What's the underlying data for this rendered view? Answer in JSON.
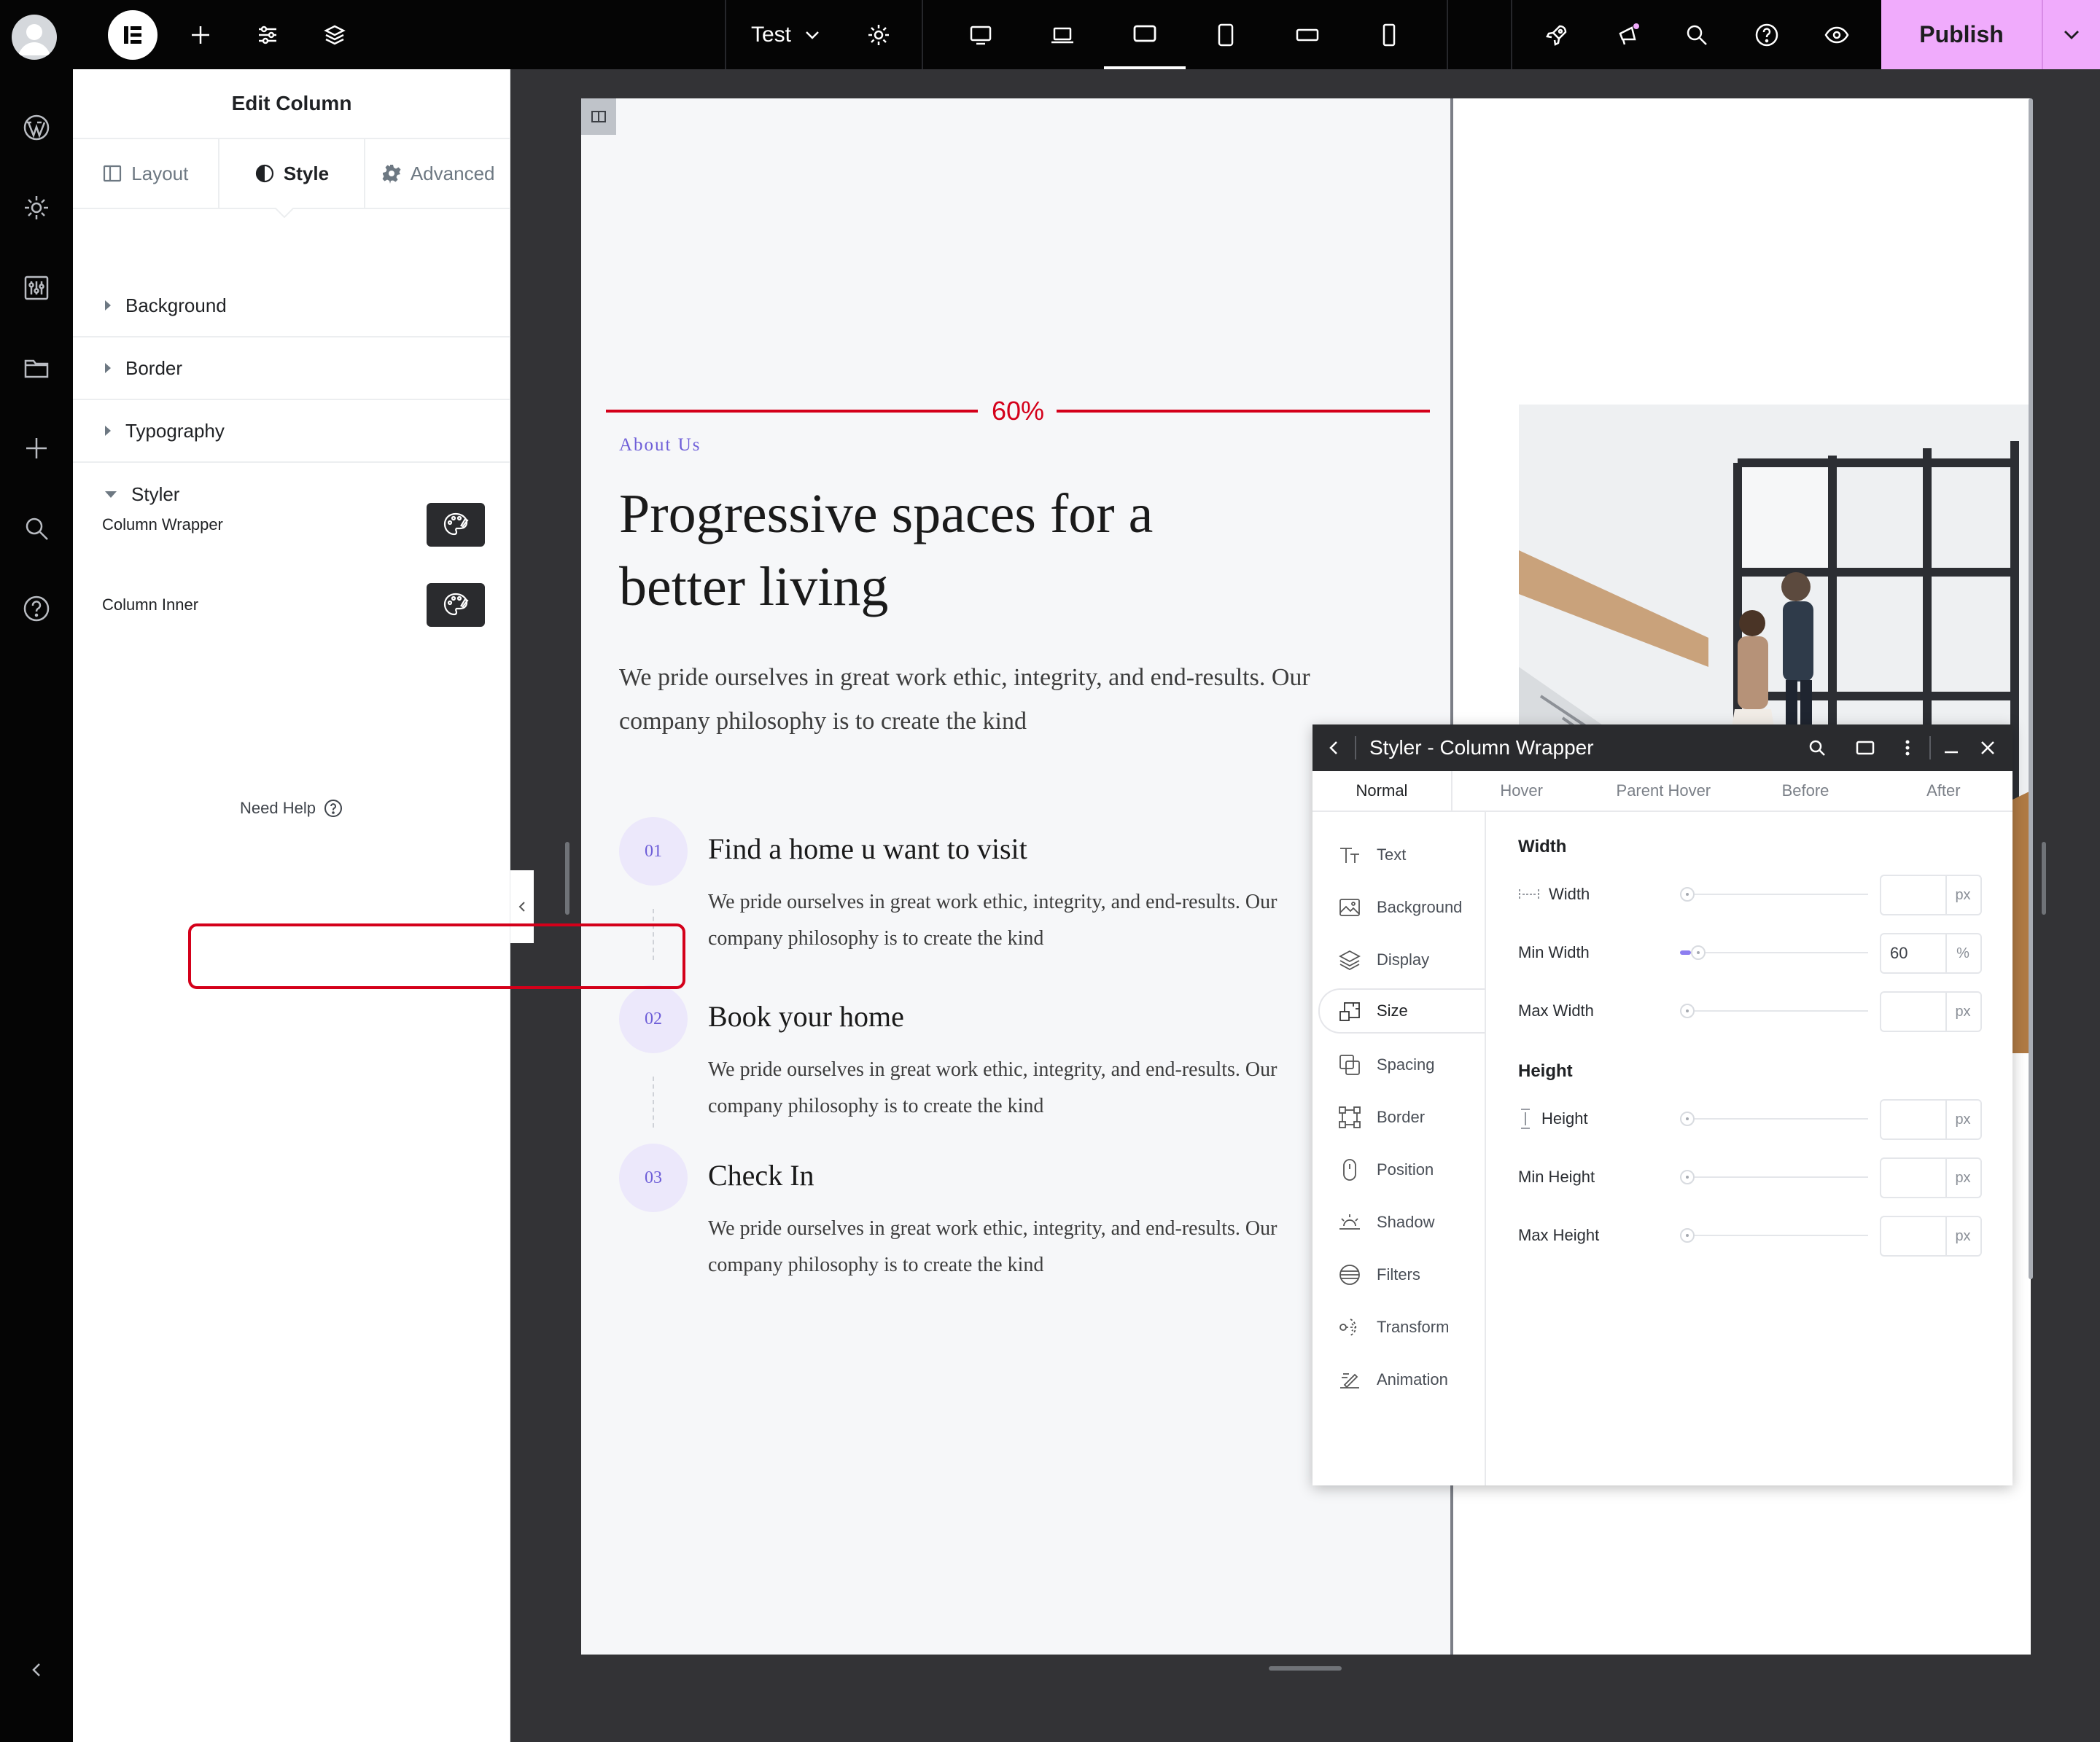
{
  "topbar": {
    "doc_title": "Test",
    "publish_label": "Publish",
    "icons": [
      "elementor-logo-icon",
      "plus-icon",
      "sliders-icon",
      "layers-icon",
      "chevron-down-icon",
      "gear-icon",
      "desktop-icon",
      "laptop-icon",
      "tablet-landscape-icon",
      "tablet-portrait-icon",
      "mobile-landscape-icon",
      "mobile-portrait-icon",
      "rocket-icon",
      "megaphone-icon",
      "search-icon",
      "help-icon",
      "eye-icon"
    ]
  },
  "rail": {
    "icons": [
      "wordpress-icon",
      "gear-icon",
      "sliders-panel-icon",
      "folder-icon",
      "plus-icon",
      "search-icon",
      "help-icon",
      "collapse-left-icon"
    ]
  },
  "panel": {
    "title": "Edit Column",
    "tabs": [
      {
        "label": "Layout",
        "icon": "layout-icon",
        "active": false
      },
      {
        "label": "Style",
        "icon": "half-circle-icon",
        "active": true
      },
      {
        "label": "Advanced",
        "icon": "gear-icon",
        "active": false
      }
    ],
    "sections": [
      {
        "label": "Background",
        "expanded": false
      },
      {
        "label": "Border",
        "expanded": false
      },
      {
        "label": "Typography",
        "expanded": false
      },
      {
        "label": "Styler",
        "expanded": true
      }
    ],
    "styler_rows": [
      {
        "label": "Column Wrapper",
        "button_icon": "palette-icon"
      },
      {
        "label": "Column Inner",
        "button_icon": "palette-icon"
      }
    ],
    "need_help": "Need Help"
  },
  "canvas": {
    "measure_label": "60%",
    "eyebrow": "About Us",
    "headline": "Progressive spaces for a better living",
    "intro": "We pride ourselves in great work ethic, integrity, and end-results. Our company philosophy is to create the kind",
    "steps": [
      {
        "num": "01",
        "title": "Find a home u want to visit",
        "body": "We pride ourselves in great work ethic, integrity, and end-results. Our company philosophy is to create the kind"
      },
      {
        "num": "02",
        "title": "Book your home",
        "body": "We pride ourselves in great work ethic, integrity, and end-results. Our company philosophy is to create the kind"
      },
      {
        "num": "03",
        "title": "Check In",
        "body": "We pride ourselves in great work ethic, integrity, and end-results. Our company philosophy is to create the kind"
      }
    ]
  },
  "styler": {
    "title": "Styler - Column Wrapper",
    "tabs": [
      "Normal",
      "Hover",
      "Parent Hover",
      "Before",
      "After"
    ],
    "active_tab": "Normal",
    "sidebar": [
      {
        "label": "Text",
        "icon": "text-icon"
      },
      {
        "label": "Background",
        "icon": "image-icon"
      },
      {
        "label": "Display",
        "icon": "layers-icon"
      },
      {
        "label": "Size",
        "icon": "size-icon",
        "active": true
      },
      {
        "label": "Spacing",
        "icon": "spacing-icon"
      },
      {
        "label": "Border",
        "icon": "border-icon"
      },
      {
        "label": "Position",
        "icon": "position-icon"
      },
      {
        "label": "Shadow",
        "icon": "shadow-icon"
      },
      {
        "label": "Filters",
        "icon": "filters-icon"
      },
      {
        "label": "Transform",
        "icon": "transform-icon"
      },
      {
        "label": "Animation",
        "icon": "animation-icon"
      }
    ],
    "width_group": "Width",
    "height_group": "Height",
    "fields": [
      {
        "label": "Width",
        "value": "",
        "unit": "px",
        "icon": "width-icon"
      },
      {
        "label": "Min Width",
        "value": "60",
        "unit": "%",
        "slider_fraction": 0.06
      },
      {
        "label": "Max Width",
        "value": "",
        "unit": "px"
      },
      {
        "label": "Height",
        "value": "",
        "unit": "px",
        "icon": "height-icon"
      },
      {
        "label": "Min Height",
        "value": "",
        "unit": "px"
      },
      {
        "label": "Max Height",
        "value": "",
        "unit": "px"
      }
    ],
    "highlight_color": "#d4001a",
    "accent_color": "#6e5ed8"
  },
  "colors": {
    "publish_bg": "#f0abfc",
    "topbar_bg": "#050505"
  }
}
